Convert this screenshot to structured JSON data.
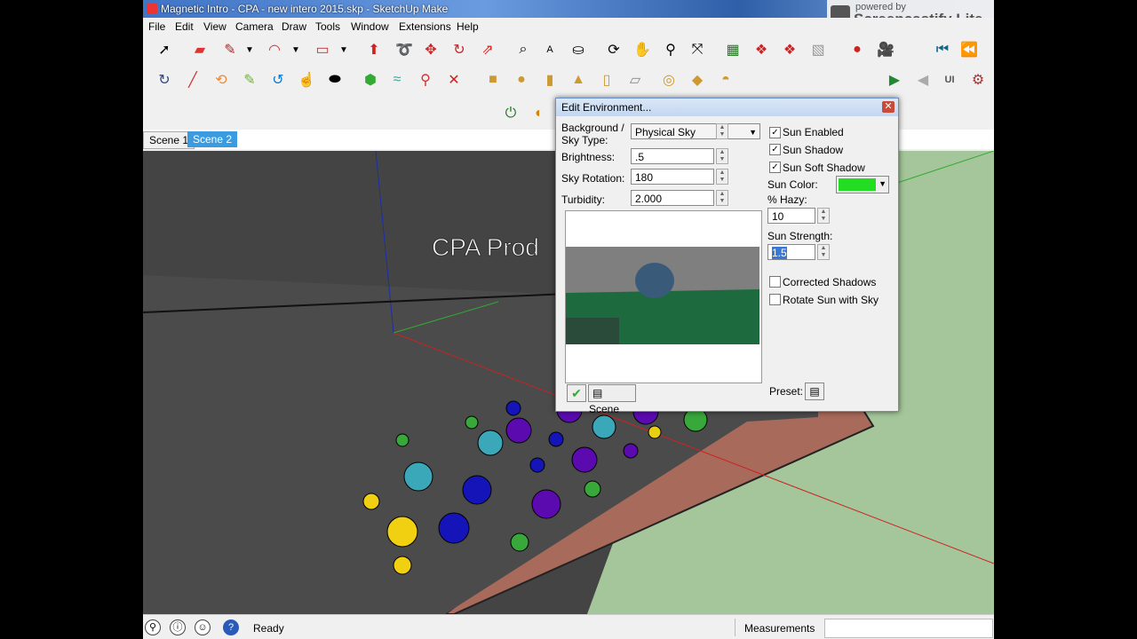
{
  "window": {
    "title": "Magnetic Intro - CPA - new intero 2015.skp - SketchUp Make",
    "watermark_small": "powered by",
    "watermark_big": "Screencastify Lite"
  },
  "menu": [
    "File",
    "Edit",
    "View",
    "Camera",
    "Draw",
    "Tools",
    "Window",
    "Extensions",
    "Help"
  ],
  "scenes": {
    "tab1": "Scene 1",
    "tab2": "Scene 2"
  },
  "viewport": {
    "overlay_text": "CPA Prod"
  },
  "dialog": {
    "title": "Edit Environment...",
    "close": "✕",
    "bg_label": "Background /\nSky Type:",
    "bg_value": "Physical Sky",
    "brightness_label": "Brightness:",
    "brightness_value": ".5",
    "rotation_label": "Sky Rotation:",
    "rotation_value": "180",
    "turbidity_label": "Turbidity:",
    "turbidity_value": "2.000",
    "sun_enabled": "Sun Enabled",
    "sun_shadow": "Sun Shadow",
    "sun_soft_shadow": "Sun Soft Shadow",
    "sun_color_label": "Sun Color:",
    "sun_color": "#22dd22",
    "hazy_label": "% Hazy:",
    "hazy_value": "10",
    "strength_label": "Sun Strength:",
    "strength_value": "1.5",
    "corrected_shadows": "Corrected Shadows",
    "rotate_sun": "Rotate Sun with Sky",
    "scene_button": "Scene",
    "preset_label": "Preset:"
  },
  "status": {
    "ready": "Ready",
    "measurements": "Measurements"
  }
}
